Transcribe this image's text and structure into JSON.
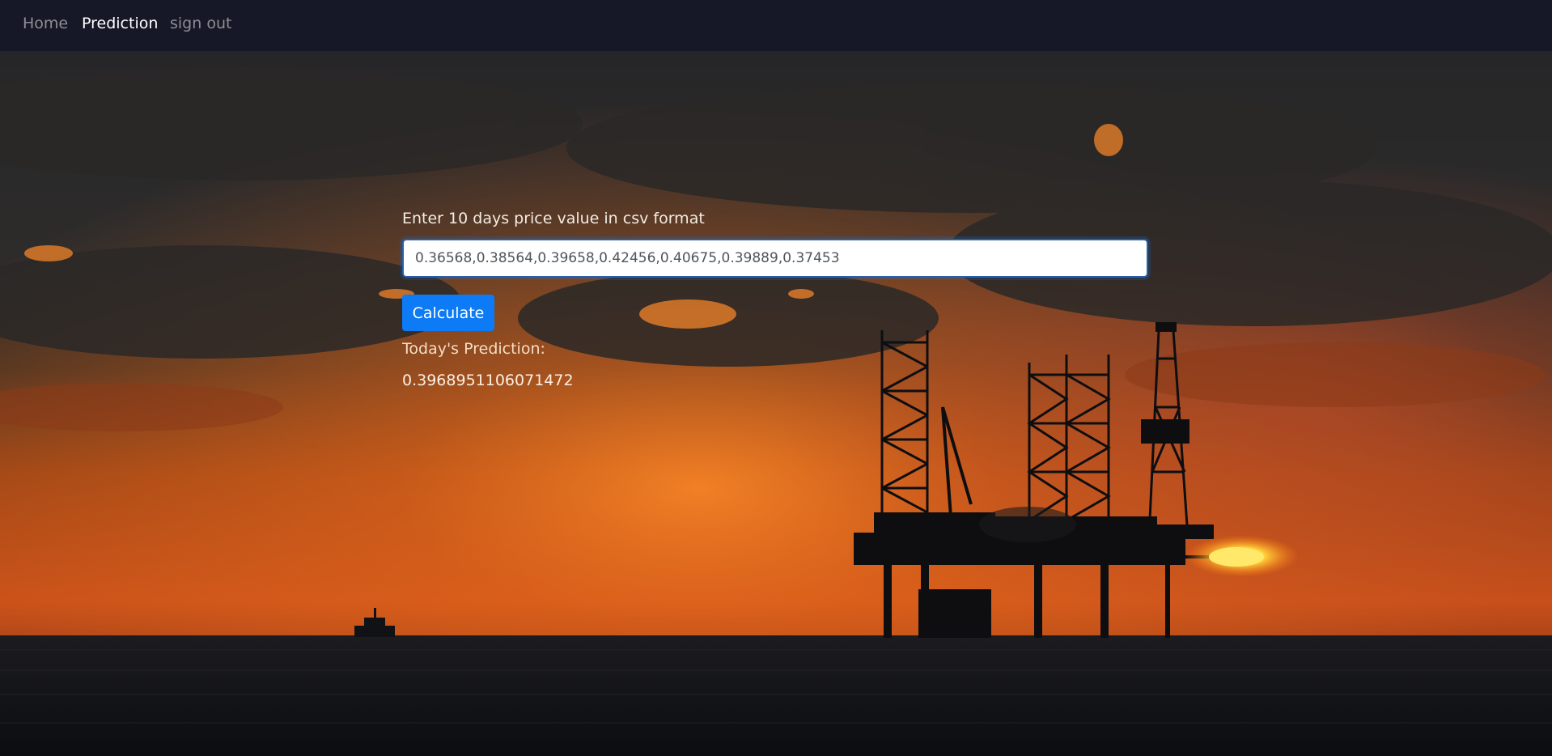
{
  "nav": {
    "items": [
      {
        "label": "Home",
        "active": false
      },
      {
        "label": "Prediction",
        "active": true
      },
      {
        "label": "sign out",
        "active": false
      }
    ]
  },
  "form": {
    "label": "Enter 10 days price value in csv format",
    "input_value": "0.36568,0.38564,0.39658,0.42456,0.40675,0.39889,0.37453",
    "calculate_label": "Calculate"
  },
  "result": {
    "label": "Today's Prediction:",
    "value": "0.3968951106071472"
  },
  "colors": {
    "navbar": "#171827",
    "button": "#0d7bf5",
    "sky_dark": "#2a2a2c",
    "sunset_orange": "#e0621c",
    "sea": "#121418"
  }
}
